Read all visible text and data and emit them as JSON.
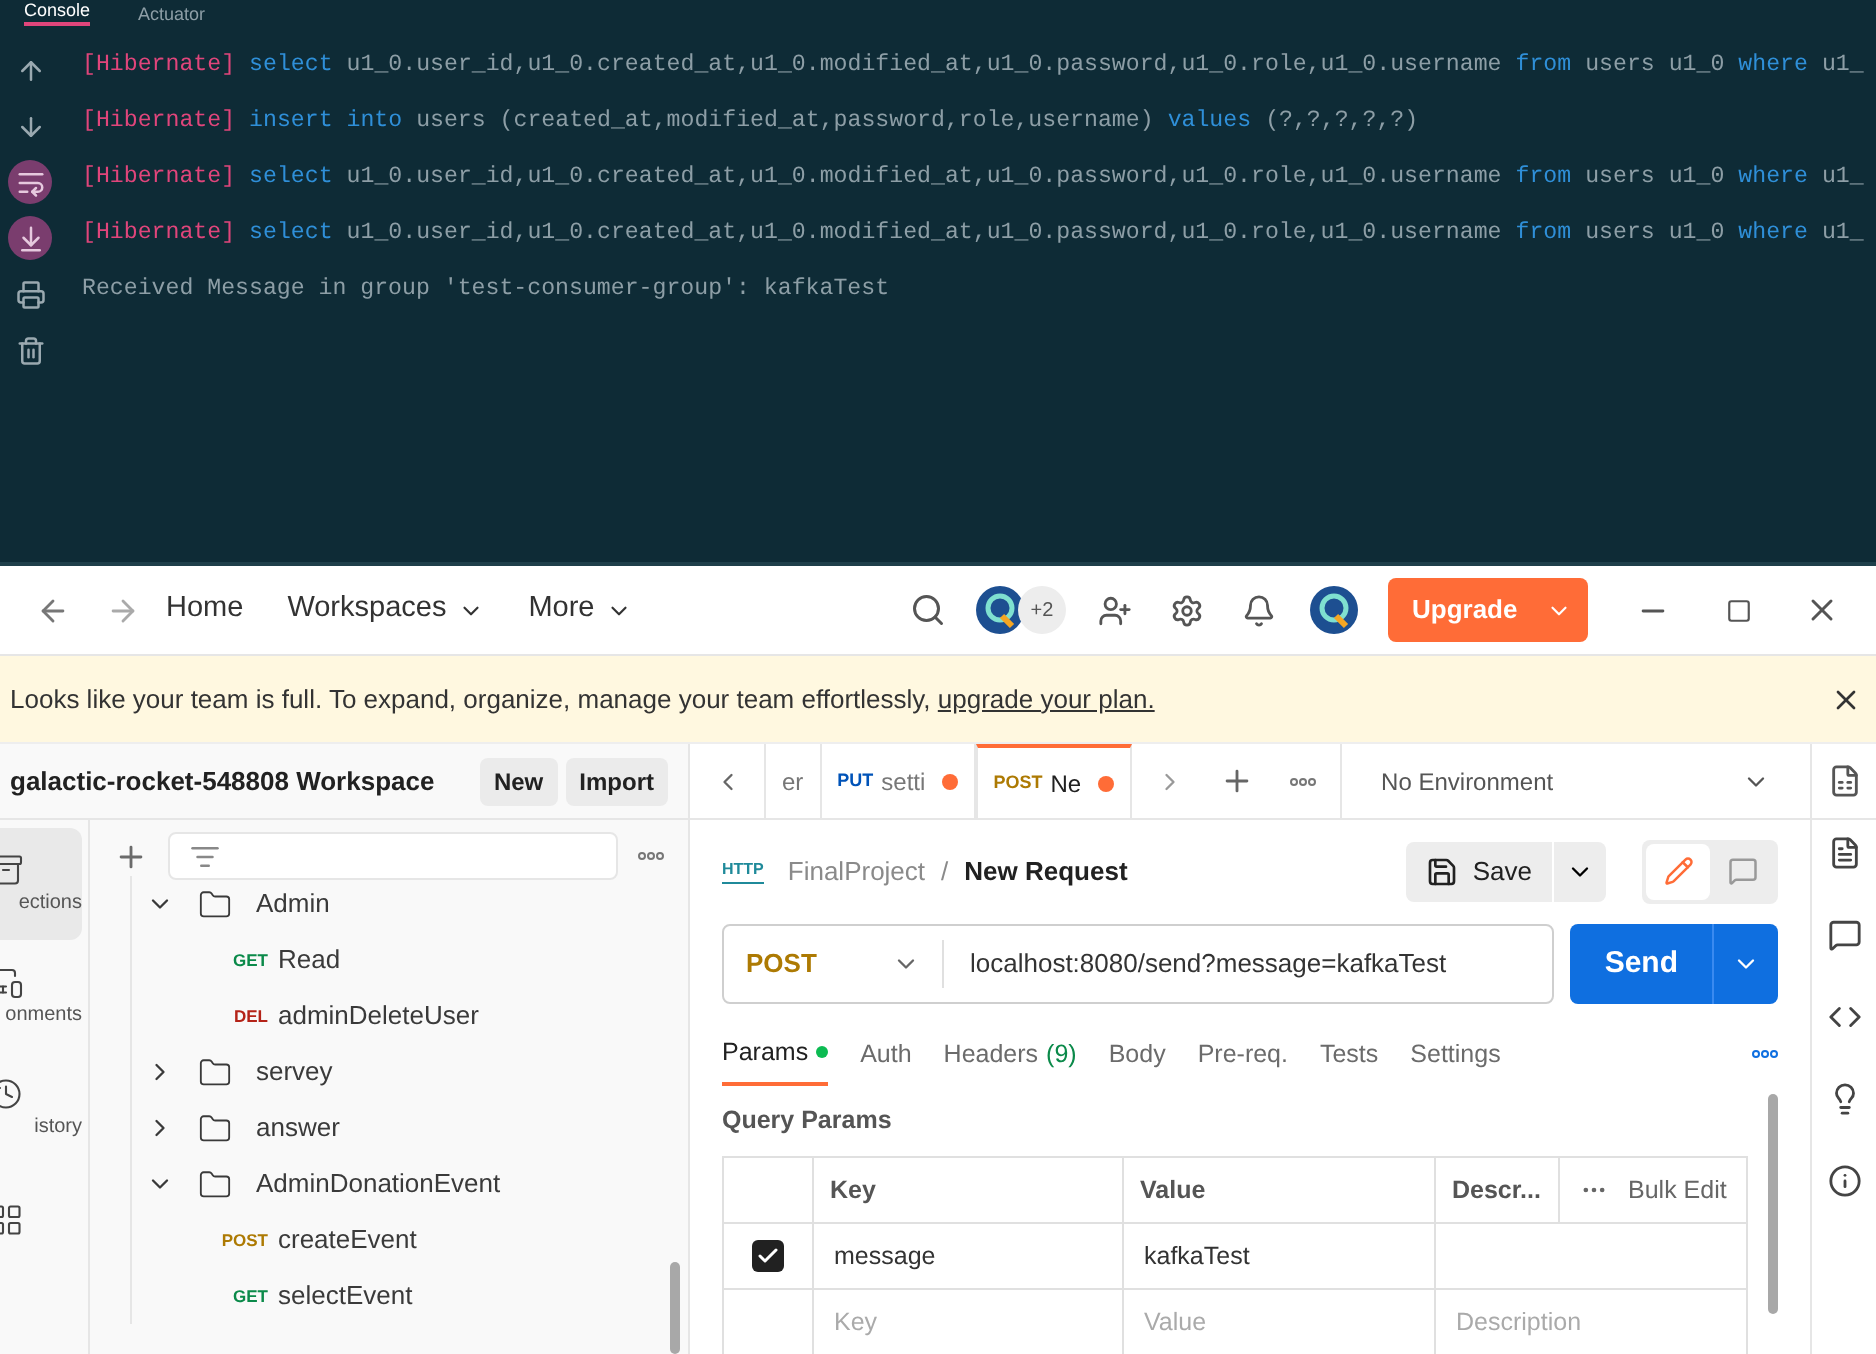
{
  "console": {
    "tabs": [
      {
        "label": "Console",
        "selected": true
      },
      {
        "label": "Actuator",
        "selected": false
      }
    ],
    "tools": [
      {
        "kind": "up",
        "on": false
      },
      {
        "kind": "down",
        "on": false
      },
      {
        "kind": "wrap",
        "on": true
      },
      {
        "kind": "scroll",
        "on": true
      },
      {
        "kind": "print",
        "on": false
      },
      {
        "kind": "clear",
        "on": false
      }
    ],
    "lines": [
      [
        {
          "kind": "tag",
          "text": "[Hibernate]"
        },
        {
          "kind": "keyword",
          "text": "select"
        },
        {
          "kind": "plain",
          "text": "u1_0.user_id,u1_0.created_at,u1_0.modified_at,u1_0.password,u1_0.role,u1_0.username"
        },
        {
          "kind": "keyword",
          "text": "from"
        },
        {
          "kind": "plain",
          "text": "users u1_0"
        },
        {
          "kind": "keyword",
          "text": "where"
        },
        {
          "kind": "plain",
          "text": "u1_"
        }
      ],
      [
        {
          "kind": "tag",
          "text": "[Hibernate]"
        },
        {
          "kind": "keyword",
          "text": "insert into"
        },
        {
          "kind": "plain",
          "text": "users (created_at,modified_at,password,role,username)"
        },
        {
          "kind": "keyword",
          "text": "values"
        },
        {
          "kind": "plain",
          "text": "(?,?,?,?,?)"
        }
      ],
      [
        {
          "kind": "tag",
          "text": "[Hibernate]"
        },
        {
          "kind": "keyword",
          "text": "select"
        },
        {
          "kind": "plain",
          "text": "u1_0.user_id,u1_0.created_at,u1_0.modified_at,u1_0.password,u1_0.role,u1_0.username"
        },
        {
          "kind": "keyword",
          "text": "from"
        },
        {
          "kind": "plain",
          "text": "users u1_0"
        },
        {
          "kind": "keyword",
          "text": "where"
        },
        {
          "kind": "plain",
          "text": "u1_"
        }
      ],
      [
        {
          "kind": "tag",
          "text": "[Hibernate]"
        },
        {
          "kind": "keyword",
          "text": "select"
        },
        {
          "kind": "plain",
          "text": "u1_0.user_id,u1_0.created_at,u1_0.modified_at,u1_0.password,u1_0.role,u1_0.username"
        },
        {
          "kind": "keyword",
          "text": "from"
        },
        {
          "kind": "plain",
          "text": "users u1_0"
        },
        {
          "kind": "keyword",
          "text": "where"
        },
        {
          "kind": "plain",
          "text": "u1_"
        }
      ],
      [
        {
          "kind": "plain",
          "text": "Received Message in group 'test-consumer-group': kafkaTest"
        }
      ]
    ]
  },
  "nav": {
    "home": "Home",
    "menus": [
      "Workspaces",
      "More"
    ],
    "avatar_count": "+2",
    "upgrade": "Upgrade"
  },
  "banner": {
    "text": "Looks like your team is full. To expand, organize, manage your team effortlessly, ",
    "link": "upgrade your plan."
  },
  "workspace": {
    "name": "galactic-rocket-548808 Workspace",
    "buttons": [
      "New",
      "Import"
    ]
  },
  "sidebar_nav": [
    {
      "kind": "collections",
      "label": "ections",
      "selected": true
    },
    {
      "kind": "environments",
      "label": "onments",
      "selected": false
    },
    {
      "kind": "history",
      "label": "istory",
      "selected": false
    },
    {
      "kind": "apps",
      "selected": false
    }
  ],
  "tree": [
    {
      "name": "Admin",
      "expanded": true,
      "children": [
        {
          "method": "GET",
          "color": "#0b8a4a",
          "name": "Read"
        },
        {
          "method": "DEL",
          "color": "#b42318",
          "name": "adminDeleteUser"
        }
      ]
    },
    {
      "name": "servey",
      "expanded": false
    },
    {
      "name": "answer",
      "expanded": false
    },
    {
      "name": "AdminDonationEvent",
      "expanded": true,
      "children": [
        {
          "method": "POST",
          "color": "#ad7a03",
          "name": "createEvent"
        },
        {
          "method": "GET",
          "color": "#0b8a4a",
          "name": "selectEvent"
        }
      ]
    }
  ],
  "request_tabs": [
    {
      "label": "er",
      "unsaved": false,
      "selected": false
    },
    {
      "method": "PUT",
      "color": "#0053b8",
      "label": "setti",
      "unsaved": true,
      "selected": false
    },
    {
      "method": "POST",
      "color": "#ad7a03",
      "label": "Ne",
      "unsaved": true,
      "selected": true
    }
  ],
  "environment": "No Environment",
  "breadcrumb": {
    "icon_text": "HTTP",
    "collection": "FinalProject",
    "separator": "/",
    "request": "New Request"
  },
  "save": "Save",
  "url_bar": {
    "method": "POST",
    "url": "localhost:8080/send?message=kafkaTest",
    "send": "Send"
  },
  "param_tabs": [
    {
      "label": "Params",
      "selected": true,
      "dot": true
    },
    {
      "label": "Auth",
      "selected": false
    },
    {
      "label": "Headers",
      "count": "(9)",
      "selected": false
    },
    {
      "label": "Body",
      "selected": false
    },
    {
      "label": "Pre-req.",
      "selected": false
    },
    {
      "label": "Tests",
      "selected": false
    },
    {
      "label": "Settings",
      "selected": false
    }
  ],
  "query_params": {
    "title": "Query Params",
    "columns": [
      "Key",
      "Value",
      "Descr..."
    ],
    "bulk_edit": "Bulk Edit",
    "rows": [
      {
        "checked": true,
        "key": "message",
        "value": "kafkaTest"
      }
    ],
    "placeholder": {
      "key": "Key",
      "value": "Value",
      "description": "Description"
    }
  }
}
